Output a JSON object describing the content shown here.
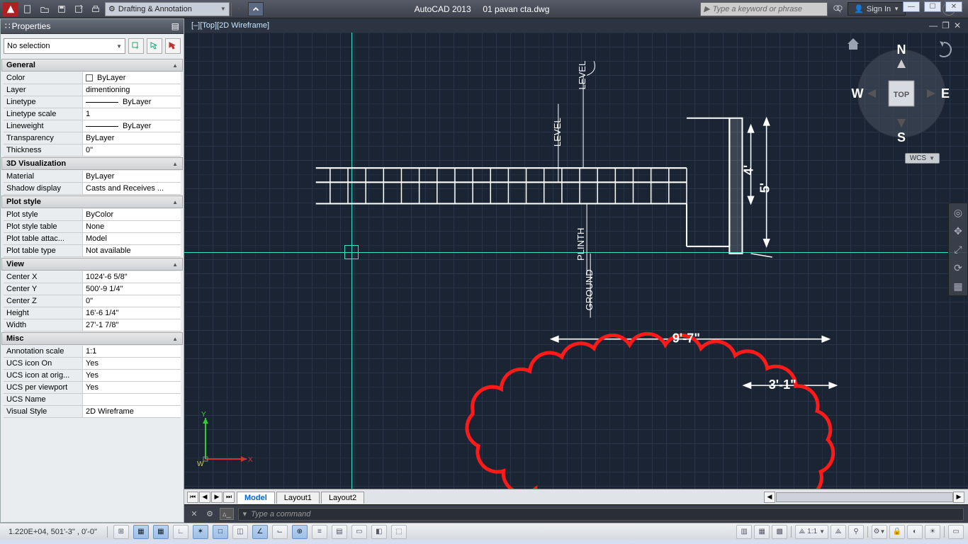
{
  "app": {
    "name": "AutoCAD 2013",
    "file": "01 pavan cta.dwg"
  },
  "workspace": "Drafting & Annotation",
  "search_placeholder": "Type a keyword or phrase",
  "signin": "Sign In",
  "viewport_label": "[‒][Top][2D Wireframe]",
  "wcs": "WCS",
  "viewcube": {
    "top": "TOP",
    "n": "N",
    "s": "S",
    "e": "E",
    "w": "W"
  },
  "properties": {
    "title": "Properties",
    "selection": "No selection",
    "groups": {
      "general": {
        "title": "General",
        "rows": {
          "color": {
            "k": "Color",
            "v": "ByLayer"
          },
          "layer": {
            "k": "Layer",
            "v": "dimentioning"
          },
          "linetype": {
            "k": "Linetype",
            "v": "ByLayer"
          },
          "ltscale": {
            "k": "Linetype scale",
            "v": "1"
          },
          "lweight": {
            "k": "Lineweight",
            "v": "ByLayer"
          },
          "transp": {
            "k": "Transparency",
            "v": "ByLayer"
          },
          "thick": {
            "k": "Thickness",
            "v": "0\""
          }
        }
      },
      "threeD": {
        "title": "3D Visualization",
        "rows": {
          "material": {
            "k": "Material",
            "v": "ByLayer"
          },
          "shadow": {
            "k": "Shadow display",
            "v": "Casts and Receives ..."
          }
        }
      },
      "plot": {
        "title": "Plot style",
        "rows": {
          "ps": {
            "k": "Plot style",
            "v": "ByColor"
          },
          "pst": {
            "k": "Plot style table",
            "v": "None"
          },
          "pta": {
            "k": "Plot table attac...",
            "v": "Model"
          },
          "ptt": {
            "k": "Plot table type",
            "v": "Not available"
          }
        }
      },
      "view": {
        "title": "View",
        "rows": {
          "cx": {
            "k": "Center X",
            "v": "1024'-6 5/8\""
          },
          "cy": {
            "k": "Center Y",
            "v": "500'-9 1/4\""
          },
          "cz": {
            "k": "Center Z",
            "v": "0\""
          },
          "h": {
            "k": "Height",
            "v": "16'-6 1/4\""
          },
          "w": {
            "k": "Width",
            "v": "27'-1 7/8\""
          }
        }
      },
      "misc": {
        "title": "Misc",
        "rows": {
          "ascale": {
            "k": "Annotation scale",
            "v": "1:1"
          },
          "ucson": {
            "k": "UCS icon On",
            "v": "Yes"
          },
          "ucsorig": {
            "k": "UCS icon at orig...",
            "v": "Yes"
          },
          "ucsvp": {
            "k": "UCS per viewport",
            "v": "Yes"
          },
          "ucsname": {
            "k": "UCS Name",
            "v": ""
          },
          "vstyle": {
            "k": "Visual Style",
            "v": "2D Wireframe"
          }
        }
      }
    }
  },
  "drawing": {
    "labels": {
      "level1": "LEVEL",
      "level2": "LEVEL",
      "plinth": "PLINTH",
      "ground": "GROUND"
    },
    "dims": {
      "d1": "9'-7\"",
      "d2": "3'-1\"",
      "d3": "4'",
      "d4": "5'"
    }
  },
  "tabs": {
    "model": "Model",
    "l1": "Layout1",
    "l2": "Layout2"
  },
  "command_placeholder": "Type a command",
  "status": {
    "coords": "1.220E+04,   501'-3\"   , 0'-0\"",
    "scale": "1:1"
  },
  "ucs_axes": {
    "x": "X",
    "y": "Y",
    "w": "W"
  }
}
